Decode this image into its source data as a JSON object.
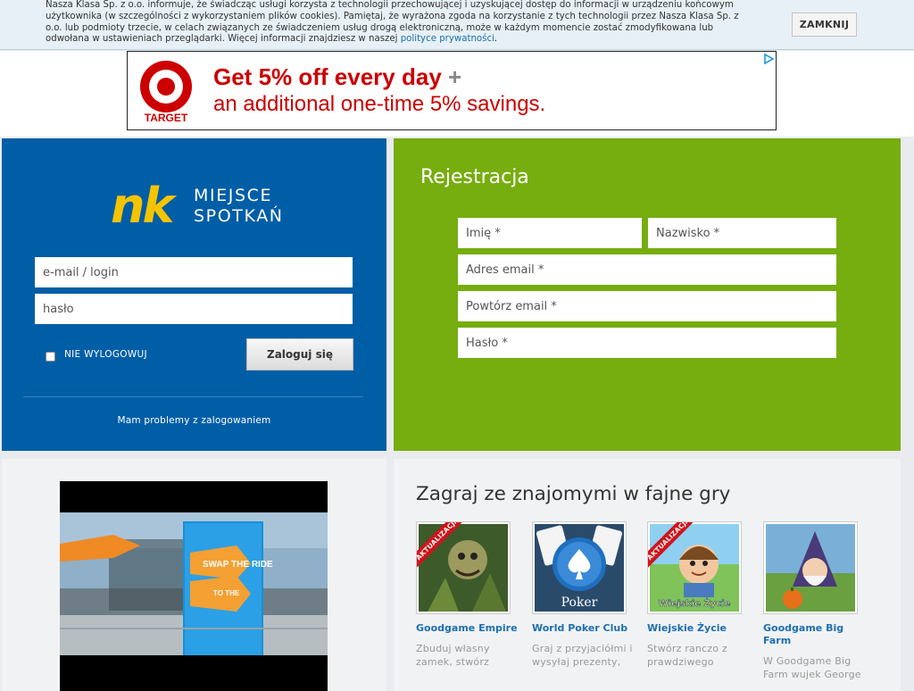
{
  "cookie": {
    "text": "Nasza Klasa Sp. z o.o. informuje, że świadcząc usługi korzysta z technologii przechowującej i uzyskującej dostęp do informacji w urządzeniu końcowym użytkownika (w szczególności z wykorzystaniem plików cookies). Pamiętaj, że wyrażona zgoda na korzystanie z tych technologii przez Nasza Klasa Sp. z o.o. lub podmioty trzecie, w celach związanych ze świadczeniem usług drogą elektroniczną, może w każdym momencie zostać zmodyfikowana lub odwołana w ustawieniach przeglądarki. Więcej informacji znajdziesz w naszej ",
    "policy_link": "polityce prywatności",
    "close_label": "ZAMKNIJ"
  },
  "ad": {
    "brand": "TARGET",
    "line1": "Get 5% off every day",
    "plus": "+",
    "line2": "an additional one-time 5% savings.",
    "choices_icon": "adchoices-icon"
  },
  "login": {
    "logo_text": "nk",
    "tagline_1": "MIEJSCE",
    "tagline_2": "SPOTKAŃ",
    "email_placeholder": "e-mail / login",
    "password_placeholder": "hasło",
    "remember_label": "NIE WYLOGOWUJ",
    "login_button": "Zaloguj się",
    "problems_link": "Mam problemy z zalogowaniem"
  },
  "register": {
    "title": "Rejestracja",
    "first_name": "Imię *",
    "last_name": "Nazwisko *",
    "email": "Adres email *",
    "email_repeat": "Powtórz email *",
    "password": "Hasło *"
  },
  "video": {
    "sign_text": "SWAP THE RIDE",
    "sign_small": "TO THE"
  },
  "games": {
    "title": "Zagraj ze znajomymi w fajne gry",
    "ribbon": "AKTUALIZACJA",
    "items": [
      {
        "name": "Goodgame Empire",
        "desc": "Zbuduj własny zamek, stwórz",
        "ribbon": true
      },
      {
        "name": "World Poker Club",
        "desc": "Graj z przyjaciółmi i wysyłaj prezenty,",
        "ribbon": false,
        "thumb_text": "Poker"
      },
      {
        "name": "Wiejskie Życie",
        "desc": "Stwórz ranczo z prawdziwego",
        "ribbon": true,
        "thumb_text": "Wiejskie Życie"
      },
      {
        "name": "Goodgame Big Farm",
        "desc": "W Goodgame Big Farm wujek George",
        "ribbon": false
      }
    ]
  },
  "colors": {
    "login_blue": "#005ea6",
    "register_green": "#76ad0f",
    "link_blue": "#1d6fb0",
    "target_red": "#cc0000",
    "nk_yellow": "#f5c400"
  }
}
